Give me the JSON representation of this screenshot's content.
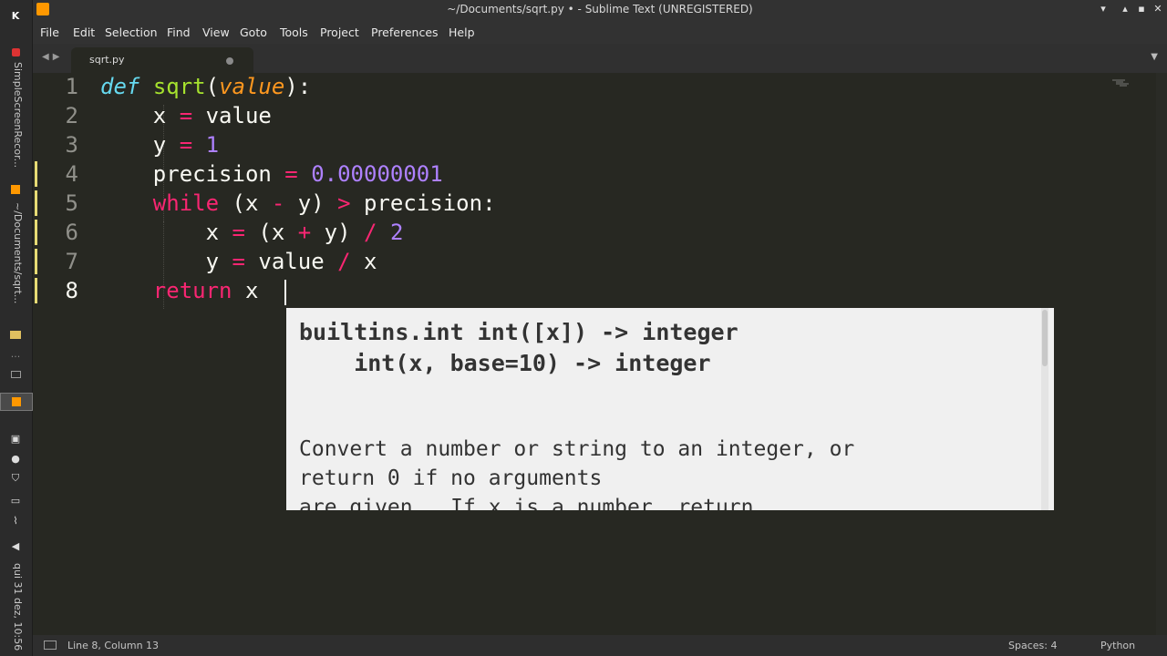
{
  "window": {
    "title": "~/Documents/sqrt.py • - Sublime Text (UNREGISTERED)"
  },
  "menu": [
    "File",
    "Edit",
    "Selection",
    "Find",
    "View",
    "Goto",
    "Tools",
    "Project",
    "Preferences",
    "Help"
  ],
  "tab": {
    "label": "sqrt.py",
    "modified": true
  },
  "editor": {
    "line_numbers": [
      "1",
      "2",
      "3",
      "4",
      "5",
      "6",
      "7",
      "8"
    ],
    "current_line": 8,
    "modified_lines": [
      4,
      5,
      6,
      7,
      8
    ]
  },
  "code": {
    "l1": {
      "kw": "def",
      "name": "sqrt",
      "open": "(",
      "param": "value",
      "close": "):"
    },
    "l2": {
      "lhs": "x",
      "op": "=",
      "rhs": "value"
    },
    "l3": {
      "lhs": "y",
      "op": "=",
      "num": "1"
    },
    "l4": {
      "lhs": "precision",
      "op": "=",
      "num": "0.00000001"
    },
    "l5": {
      "kw": "while",
      "t1": "(x",
      "op1": "-",
      "t2": "y)",
      "op2": ">",
      "t3": "precision:"
    },
    "l6": {
      "lhs": "x",
      "op": "=",
      "t1": "(x",
      "op2": "+",
      "t2": "y)",
      "op3": "/",
      "num": "2"
    },
    "l7": {
      "lhs": "y",
      "op": "=",
      "t1": "value",
      "op2": "/",
      "t2": "x"
    },
    "l8": {
      "kw": "return",
      "t1": "x"
    }
  },
  "popup": {
    "sig1": "builtins.int int([x]) -> integer",
    "sig2": "    int(x, base=10) -> integer",
    "doc1": "Convert a number or string to an integer, or",
    "doc2": "return 0 if no arguments",
    "doc3": "are given.  If x is a number, return"
  },
  "status": {
    "position": "Line 8, Column 13",
    "indent": "Spaces: 4",
    "syntax": "Python"
  },
  "taskbar": {
    "item1": "SimpleScreenRecor...",
    "item2": "~/Documents/sqrt...",
    "clock": "qui 31 dez, 10:56"
  },
  "colors": {
    "background": "#272822",
    "keyword": "#f92672",
    "function": "#a6e22e",
    "param": "#fd971f",
    "number": "#ae81ff",
    "storage": "#66d9ef"
  },
  "icons": [
    "k-icon",
    "record-icon",
    "sublime-icon",
    "minimize-icon",
    "maximize-icon",
    "close-icon",
    "back-arrow-icon",
    "forward-arrow-icon",
    "dropdown-icon"
  ]
}
